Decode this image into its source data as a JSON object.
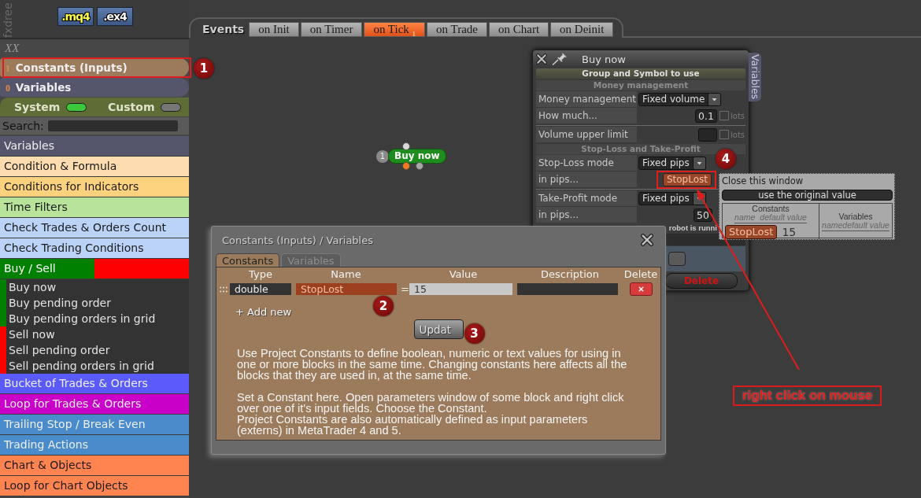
{
  "header": {
    "brand": "fxdree",
    "files": [
      {
        "label": ".mq4",
        "kind": "source"
      },
      {
        "label": ".ex4",
        "kind": "compiled"
      }
    ]
  },
  "sidebar": {
    "title": "XX",
    "panels": [
      {
        "count": "1",
        "label": "Constants (Inputs)",
        "color": "#9b7b5b",
        "highlighted": true,
        "marker": "1"
      },
      {
        "count": "0",
        "label": "Variables",
        "color": "#55556b",
        "highlighted": false
      }
    ],
    "toggles": [
      {
        "label": "System",
        "on": true
      },
      {
        "label": "Custom",
        "on": false
      }
    ],
    "search": {
      "label": "Search:"
    },
    "categories": [
      {
        "kind": "item",
        "label": "Variables",
        "color": "#55556b"
      },
      {
        "kind": "item",
        "label": "Condition & Formula",
        "color": "#fddcb0"
      },
      {
        "kind": "item",
        "label": "Conditions for Indicators",
        "color": "#fdd27f"
      },
      {
        "kind": "item",
        "label": "Time Filters",
        "color": "#b7e39b"
      },
      {
        "kind": "item",
        "label": "Check Trades & Orders Count",
        "color": "#bad3f7"
      },
      {
        "kind": "item",
        "label": "Check Trading Conditions",
        "color": "#bad3f7"
      },
      {
        "kind": "group",
        "label": "Buy / Sell",
        "children": [
          {
            "label": "Buy now",
            "color": "#008000"
          },
          {
            "label": "Buy pending order",
            "color": "#008000"
          },
          {
            "label": "Buy pending orders in grid",
            "color": "#008000"
          },
          {
            "label": "Sell now",
            "color": "#ff0000"
          },
          {
            "label": "Sell pending order",
            "color": "#ff0000"
          },
          {
            "label": "Sell pending orders in grid",
            "color": "#ff0000"
          }
        ]
      },
      {
        "kind": "item",
        "label": "Bucket of Trades & Orders",
        "color": "#5b5bfb"
      },
      {
        "kind": "item",
        "label": "Loop for Trades & Orders",
        "color": "#c800c8"
      },
      {
        "kind": "item",
        "label": "Trailing Stop / Break Even",
        "color": "#4a8ccb"
      },
      {
        "kind": "item",
        "label": "Trading Actions",
        "color": "#4a8ccb"
      },
      {
        "kind": "item",
        "label": "Chart & Objects",
        "color": "#ff8450"
      },
      {
        "kind": "item",
        "label": "Loop for Chart Objects",
        "color": "#ff8450"
      }
    ]
  },
  "events": {
    "label": "Events",
    "tabs": [
      {
        "label": "on Init",
        "selected": false
      },
      {
        "label": "on Timer",
        "selected": false
      },
      {
        "label": "on Tick",
        "selected": true,
        "count": "1"
      },
      {
        "label": "on Trade",
        "selected": false
      },
      {
        "label": "on Chart",
        "selected": false
      },
      {
        "label": "on Deinit",
        "selected": false
      }
    ]
  },
  "canvas": {
    "blocks": [
      {
        "count": "1",
        "label": "Buy now"
      }
    ]
  },
  "params_window": {
    "title": "Buy now",
    "side_tab": "Variables",
    "rows": [
      {
        "kind": "group",
        "label": "Group and Symbol to use"
      },
      {
        "kind": "section",
        "label": "Money management"
      },
      {
        "kind": "select",
        "label": "Money management",
        "value": "Fixed volume"
      },
      {
        "kind": "number",
        "label": "How much...",
        "value": "0.1",
        "checked": false,
        "unit": "lots"
      },
      {
        "kind": "divider"
      },
      {
        "kind": "number",
        "label": "Volume upper limit",
        "checked": false,
        "unit": "lots"
      },
      {
        "kind": "section",
        "label": "Stop-Loss and Take-Profit"
      },
      {
        "kind": "select",
        "label": "Stop-Loss mode",
        "value": "Fixed pips"
      },
      {
        "kind": "constant",
        "label": "in pips...",
        "value": "StopLost",
        "highlighted": true,
        "marker": "4"
      },
      {
        "kind": "divider"
      },
      {
        "kind": "select",
        "label": "Take-Profit mode",
        "value": "Fixed pips"
      },
      {
        "kind": "number",
        "label": "in pips...",
        "value": "50"
      },
      {
        "kind": "note",
        "label": "robot is runni"
      },
      {
        "kind": "section"
      },
      {
        "kind": "field"
      },
      {
        "kind": "button",
        "label": "Delete"
      }
    ]
  },
  "context_menu": {
    "close_label": "Close this window",
    "original_button": "use the original value",
    "constants": {
      "title": "Constants",
      "columns": [
        "name",
        "default value"
      ],
      "rows": [
        {
          "name": "StopLost",
          "value": "15"
        }
      ]
    },
    "variables": {
      "title": "Variables",
      "columns": [
        "name",
        "default value"
      ]
    }
  },
  "dialog": {
    "title": "Constants (Inputs) / Variables",
    "tabs": [
      {
        "label": "Constants",
        "selected": true
      },
      {
        "label": "Variables",
        "selected": false
      }
    ],
    "columns": [
      "Type",
      "Name",
      "Value",
      "Description",
      "Delete"
    ],
    "rows": [
      {
        "type": "double",
        "name": "StopLost",
        "operator": "=",
        "value": "15",
        "marker": "2"
      }
    ],
    "add_label": "+ Add new",
    "update_label": "Updat",
    "update_marker": "3",
    "help": [
      [
        "Use Project Constants to define boolean, numeric or text values for using in one or more blocks in the same time. Changing constants here affects all the blocks that they are used in, at the same time."
      ],
      [
        "Set a Constant here. Open parameters window of some block and right click over one of it's input fields. Choose the Constant.",
        "Project Constants are also automatically defined as input parameters (externs) in MetaTrader 4 and 5."
      ]
    ]
  },
  "callout": {
    "text": "right click on mouse"
  }
}
